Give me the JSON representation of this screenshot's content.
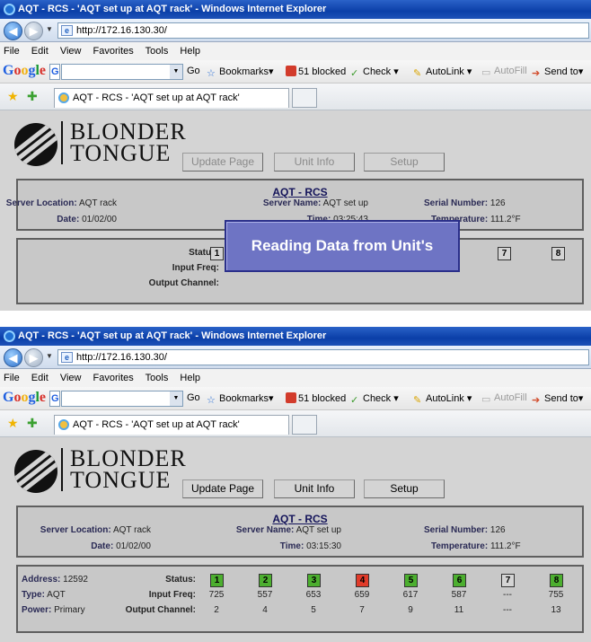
{
  "browser": {
    "window_title": "AQT - RCS - 'AQT set up at AQT rack' - Windows Internet Explorer",
    "url": "http://172.16.130.30/",
    "menu": [
      "File",
      "Edit",
      "View",
      "Favorites",
      "Tools",
      "Help"
    ],
    "google": {
      "logo": [
        "G",
        "o",
        "o",
        "g",
        "l",
        "e"
      ],
      "g_button": "G",
      "go": "Go",
      "bookmarks": "Bookmarks",
      "blocked": "51 blocked",
      "check": "Check",
      "autolink": "AutoLink",
      "autofill": "AutoFill",
      "send_to": "Send to"
    },
    "tab_label": "AQT - RCS - 'AQT set up at AQT rack'"
  },
  "logo": {
    "line1": "BLONDER",
    "line2": "TONGUE"
  },
  "buttons": {
    "update": "Update Page",
    "unit_info": "Unit Info",
    "setup": "Setup"
  },
  "screens": [
    {
      "buttons_enabled": false,
      "title": "AQT - RCS",
      "server_location": {
        "label": "Server Location:",
        "value": "AQT rack"
      },
      "server_name": {
        "label": "Server Name:",
        "value": "AQT set up"
      },
      "serial_number": {
        "label": "Serial Number:",
        "value": "126"
      },
      "date": {
        "label": "Date:",
        "value": "01/02/00"
      },
      "time": {
        "label": "Time:",
        "value": "03:25:43"
      },
      "temperature": {
        "label": "Temperature:",
        "value": "111.2°F"
      },
      "status_label": "Status:",
      "input_freq_label": "Input Freq:",
      "output_channel_label": "Output Channel:",
      "visible_channels": [
        "1",
        "7",
        "8"
      ],
      "overlay": "Reading Data from Unit's"
    },
    {
      "buttons_enabled": true,
      "title": "AQT - RCS",
      "server_location": {
        "label": "Server Location:",
        "value": "AQT rack"
      },
      "server_name": {
        "label": "Server Name:",
        "value": "AQT set up"
      },
      "serial_number": {
        "label": "Serial Number:",
        "value": "126"
      },
      "date": {
        "label": "Date:",
        "value": "01/02/00"
      },
      "time": {
        "label": "Time:",
        "value": "03:15:30"
      },
      "temperature": {
        "label": "Temperature:",
        "value": "111.2°F"
      },
      "address": {
        "label": "Address:",
        "value": "12592"
      },
      "type": {
        "label": "Type:",
        "value": "AQT"
      },
      "power": {
        "label": "Power:",
        "value": "Primary"
      },
      "status_label": "Status:",
      "input_freq_label": "Input Freq:",
      "output_channel_label": "Output Channel:",
      "channels": [
        {
          "n": "1",
          "state": "ok",
          "input_freq": "725",
          "output_channel": "2"
        },
        {
          "n": "2",
          "state": "ok",
          "input_freq": "557",
          "output_channel": "4"
        },
        {
          "n": "3",
          "state": "ok",
          "input_freq": "653",
          "output_channel": "5"
        },
        {
          "n": "4",
          "state": "alarm",
          "input_freq": "659",
          "output_channel": "7"
        },
        {
          "n": "5",
          "state": "ok",
          "input_freq": "617",
          "output_channel": "9"
        },
        {
          "n": "6",
          "state": "ok",
          "input_freq": "587",
          "output_channel": "11"
        },
        {
          "n": "7",
          "state": "off",
          "input_freq": "---",
          "output_channel": "---"
        },
        {
          "n": "8",
          "state": "ok",
          "input_freq": "755",
          "output_channel": "13"
        }
      ]
    }
  ],
  "colors": {
    "status_ok": "#4caf2f",
    "status_alarm": "#e03b2a",
    "status_off": "#d4d4d4",
    "title_blue": "#14145a"
  }
}
